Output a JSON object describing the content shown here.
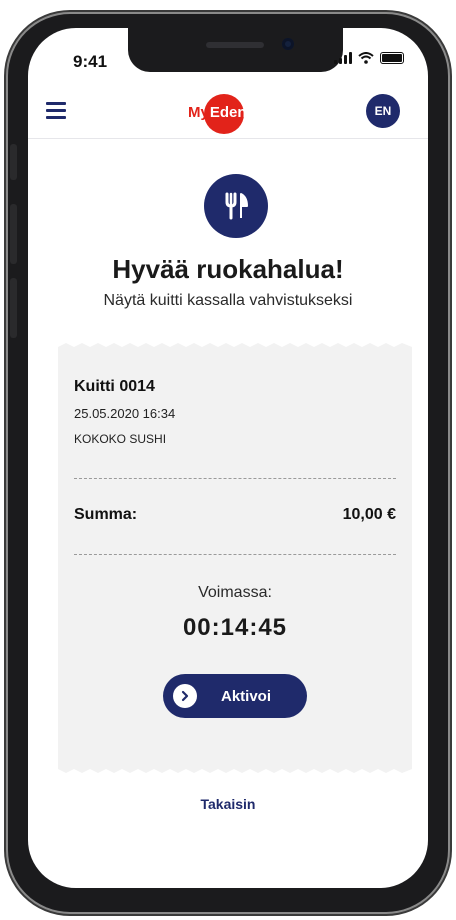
{
  "status_bar": {
    "time": "9:41"
  },
  "header": {
    "logo_my": "My",
    "logo_edenred": "Edenred",
    "language": "EN"
  },
  "hero": {
    "icon": "cutlery-icon",
    "title": "Hyvää ruokahalua!",
    "subtitle": "Näytä kuitti kassalla vahvistukseksi"
  },
  "receipt": {
    "title": "Kuitti 0014",
    "date": "25.05.2020 16:34",
    "shop": "KOKOKO SUSHI",
    "sum_label": "Summa:",
    "sum_value": "10,00 €",
    "valid_label": "Voimassa:",
    "timer": "00:14:45",
    "activate_label": "Aktivoi"
  },
  "footer": {
    "back_label": "Takaisin"
  },
  "colors": {
    "brand_navy": "#1f2a6b",
    "brand_red": "#e2231a",
    "receipt_bg": "#f2f2f2"
  }
}
